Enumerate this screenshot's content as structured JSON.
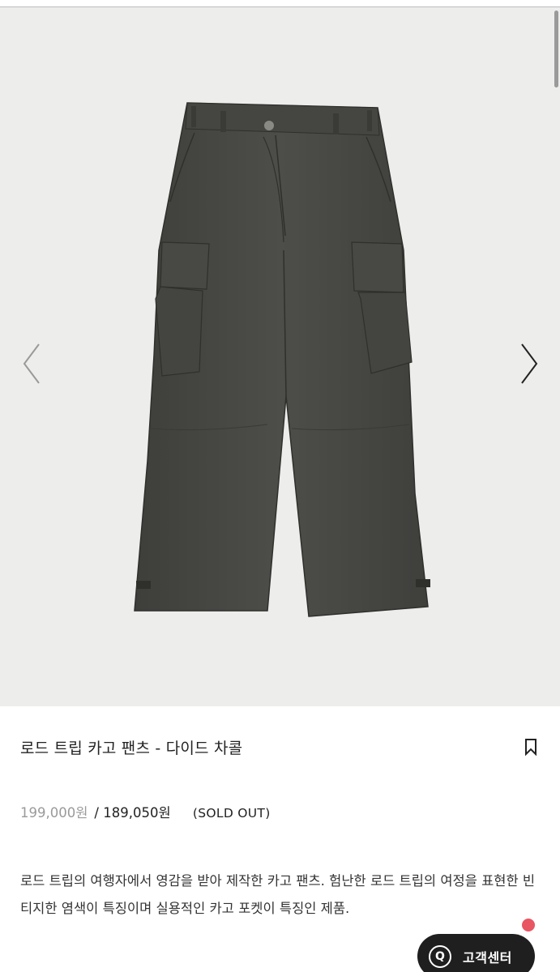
{
  "gallery": {
    "image_alt": "Dyed charcoal cargo pants product photo",
    "prev_icon": "chevron-left-icon",
    "next_icon": "chevron-right-icon"
  },
  "product": {
    "title": "로드 트립 카고 팬츠 - 다이드 차콜",
    "bookmark_icon": "bookmark-icon",
    "original_price": "199,000원",
    "separator": "/",
    "sale_price": "189,050원",
    "status": "(SOLD OUT)",
    "description": "로드 트립의 여행자에서 영감을 받아 제작한 카고 팬츠. 험난한 로드 트립의 여정을 표현한 빈티지한 염색이 특징이며 실용적인 카고 포켓이 특징인 제품."
  },
  "customer_service": {
    "icon_glyph": "Q",
    "label": "고객센터",
    "notification_color": "#e85563"
  },
  "colors": {
    "gallery_bg": "#ededec",
    "pants": "#4a4a46"
  }
}
